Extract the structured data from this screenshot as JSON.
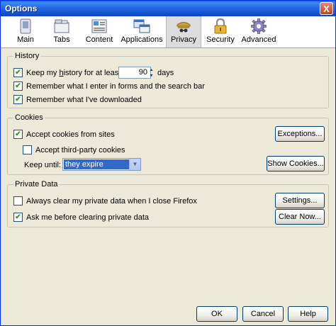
{
  "window": {
    "title": "Options",
    "close_glyph": "X"
  },
  "tabs": [
    {
      "label": "Main",
      "icon": "main-icon"
    },
    {
      "label": "Tabs",
      "icon": "tabs-icon"
    },
    {
      "label": "Content",
      "icon": "content-icon"
    },
    {
      "label": "Applications",
      "icon": "applications-icon"
    },
    {
      "label": "Privacy",
      "icon": "privacy-icon",
      "selected": true
    },
    {
      "label": "Security",
      "icon": "security-icon"
    },
    {
      "label": "Advanced",
      "icon": "advanced-icon"
    }
  ],
  "history": {
    "legend": "History",
    "keep_history": {
      "checked": true,
      "label_before": "Keep my ",
      "label_access": "h",
      "label_after": "istory for at least",
      "days_value": "90",
      "days_label": "days"
    },
    "remember_forms": {
      "checked": true,
      "label": "Remember what I enter in forms and the search bar"
    },
    "remember_downloads": {
      "checked": true,
      "label": "Remember what I've downloaded"
    }
  },
  "cookies": {
    "legend": "Cookies",
    "accept_cookies": {
      "checked": true,
      "label": "Accept cookies from sites"
    },
    "third_party": {
      "checked": false,
      "label": "Accept third-party cookies"
    },
    "keep_until_label": "Keep until:",
    "keep_until_value": "they expire",
    "exceptions_label": "Exceptions...",
    "show_cookies_label": "Show Cookies..."
  },
  "private_data": {
    "legend": "Private Data",
    "always_clear": {
      "checked": false,
      "label": "Always clear my private data when I close Firefox"
    },
    "ask_before": {
      "checked": true,
      "label": "Ask me before clearing private data"
    },
    "settings_label": "Settings...",
    "clear_now_label": "Clear Now..."
  },
  "footer": {
    "ok_label": "OK",
    "cancel_label": "Cancel",
    "help_label": "Help"
  },
  "colors": {
    "titlebar": "#0a5fd8",
    "selection": "#316ac5",
    "dialog_bg": "#ece9d8",
    "check": "#21a121"
  }
}
